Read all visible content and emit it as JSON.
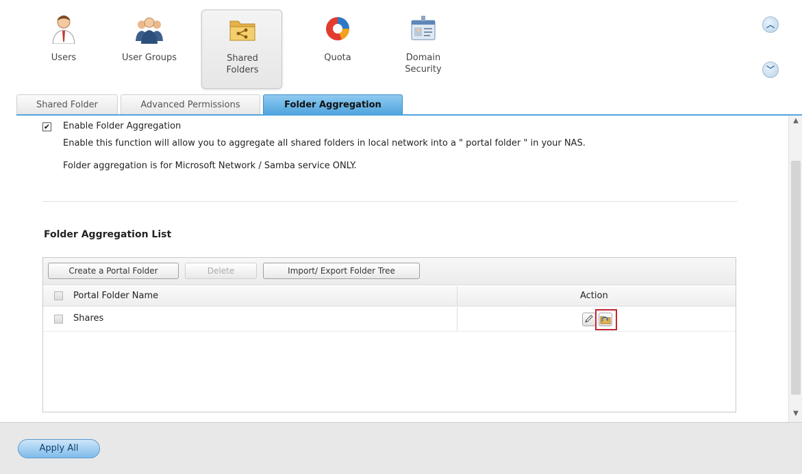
{
  "toolbar": {
    "items": [
      {
        "label": "Users",
        "icon": "user-icon"
      },
      {
        "label": "User Groups",
        "icon": "user-groups-icon"
      },
      {
        "label": "Shared\nFolders",
        "icon": "shared-folder-icon"
      },
      {
        "label": "Quota",
        "icon": "quota-pie-icon"
      },
      {
        "label": "Domain\nSecurity",
        "icon": "domain-security-icon"
      }
    ],
    "selected": "Shared Folders"
  },
  "tabs": [
    {
      "label": "Shared Folder"
    },
    {
      "label": "Advanced Permissions"
    },
    {
      "label": "Folder Aggregation"
    }
  ],
  "active_tab": "Folder Aggregation",
  "enable": {
    "checked": "✔",
    "label": "Enable Folder Aggregation",
    "description": "Enable this function will allow you to aggregate all shared folders in local network into a \" portal folder \" in your NAS.",
    "note": "Folder aggregation is for Microsoft Network / Samba service ONLY."
  },
  "list": {
    "title": "Folder Aggregation List",
    "buttons": {
      "create": "Create a Portal Folder",
      "delete": "Delete",
      "import_export": "Import/ Export Folder Tree"
    },
    "columns": {
      "name": "Portal Folder Name",
      "action": "Action"
    },
    "rows": [
      {
        "name": "Shares",
        "actions": [
          "edit-icon",
          "folder-tree-icon"
        ]
      }
    ]
  },
  "footer": {
    "apply_all": "Apply All"
  },
  "colors": {
    "accent": "#4fa4dd",
    "highlight": "#c0262d"
  }
}
